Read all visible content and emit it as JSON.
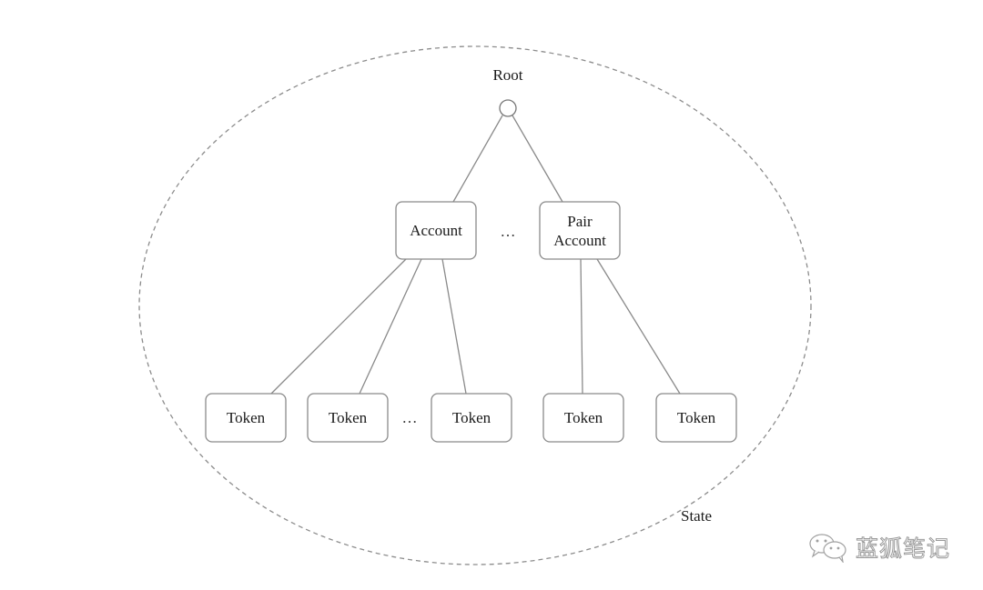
{
  "diagram": {
    "title": "",
    "boundary_label": "State",
    "root": {
      "label": "Root"
    },
    "level1": [
      {
        "id": "account",
        "label_lines": [
          "Account"
        ]
      },
      {
        "id": "gap",
        "label_lines": [
          "…"
        ],
        "is_ellipsis": true
      },
      {
        "id": "pair-account",
        "label_lines": [
          "Pair",
          "Account"
        ]
      }
    ],
    "level2": [
      {
        "id": "token-1",
        "label": "Token",
        "parent": "account"
      },
      {
        "id": "token-2",
        "label": "Token",
        "parent": "account"
      },
      {
        "id": "gap",
        "label": "…",
        "is_ellipsis": true
      },
      {
        "id": "token-3",
        "label": "Token",
        "parent": "account"
      },
      {
        "id": "token-4",
        "label": "Token",
        "parent": "pair-account"
      },
      {
        "id": "token-5",
        "label": "Token",
        "parent": "pair-account"
      }
    ],
    "edges": [
      [
        "root",
        "account"
      ],
      [
        "root",
        "pair-account"
      ],
      [
        "account",
        "token-1"
      ],
      [
        "account",
        "token-2"
      ],
      [
        "account",
        "token-3"
      ],
      [
        "pair-account",
        "token-4"
      ],
      [
        "pair-account",
        "token-5"
      ]
    ]
  },
  "watermark": {
    "icon": "wechat-icon",
    "text": "蓝狐笔记"
  }
}
